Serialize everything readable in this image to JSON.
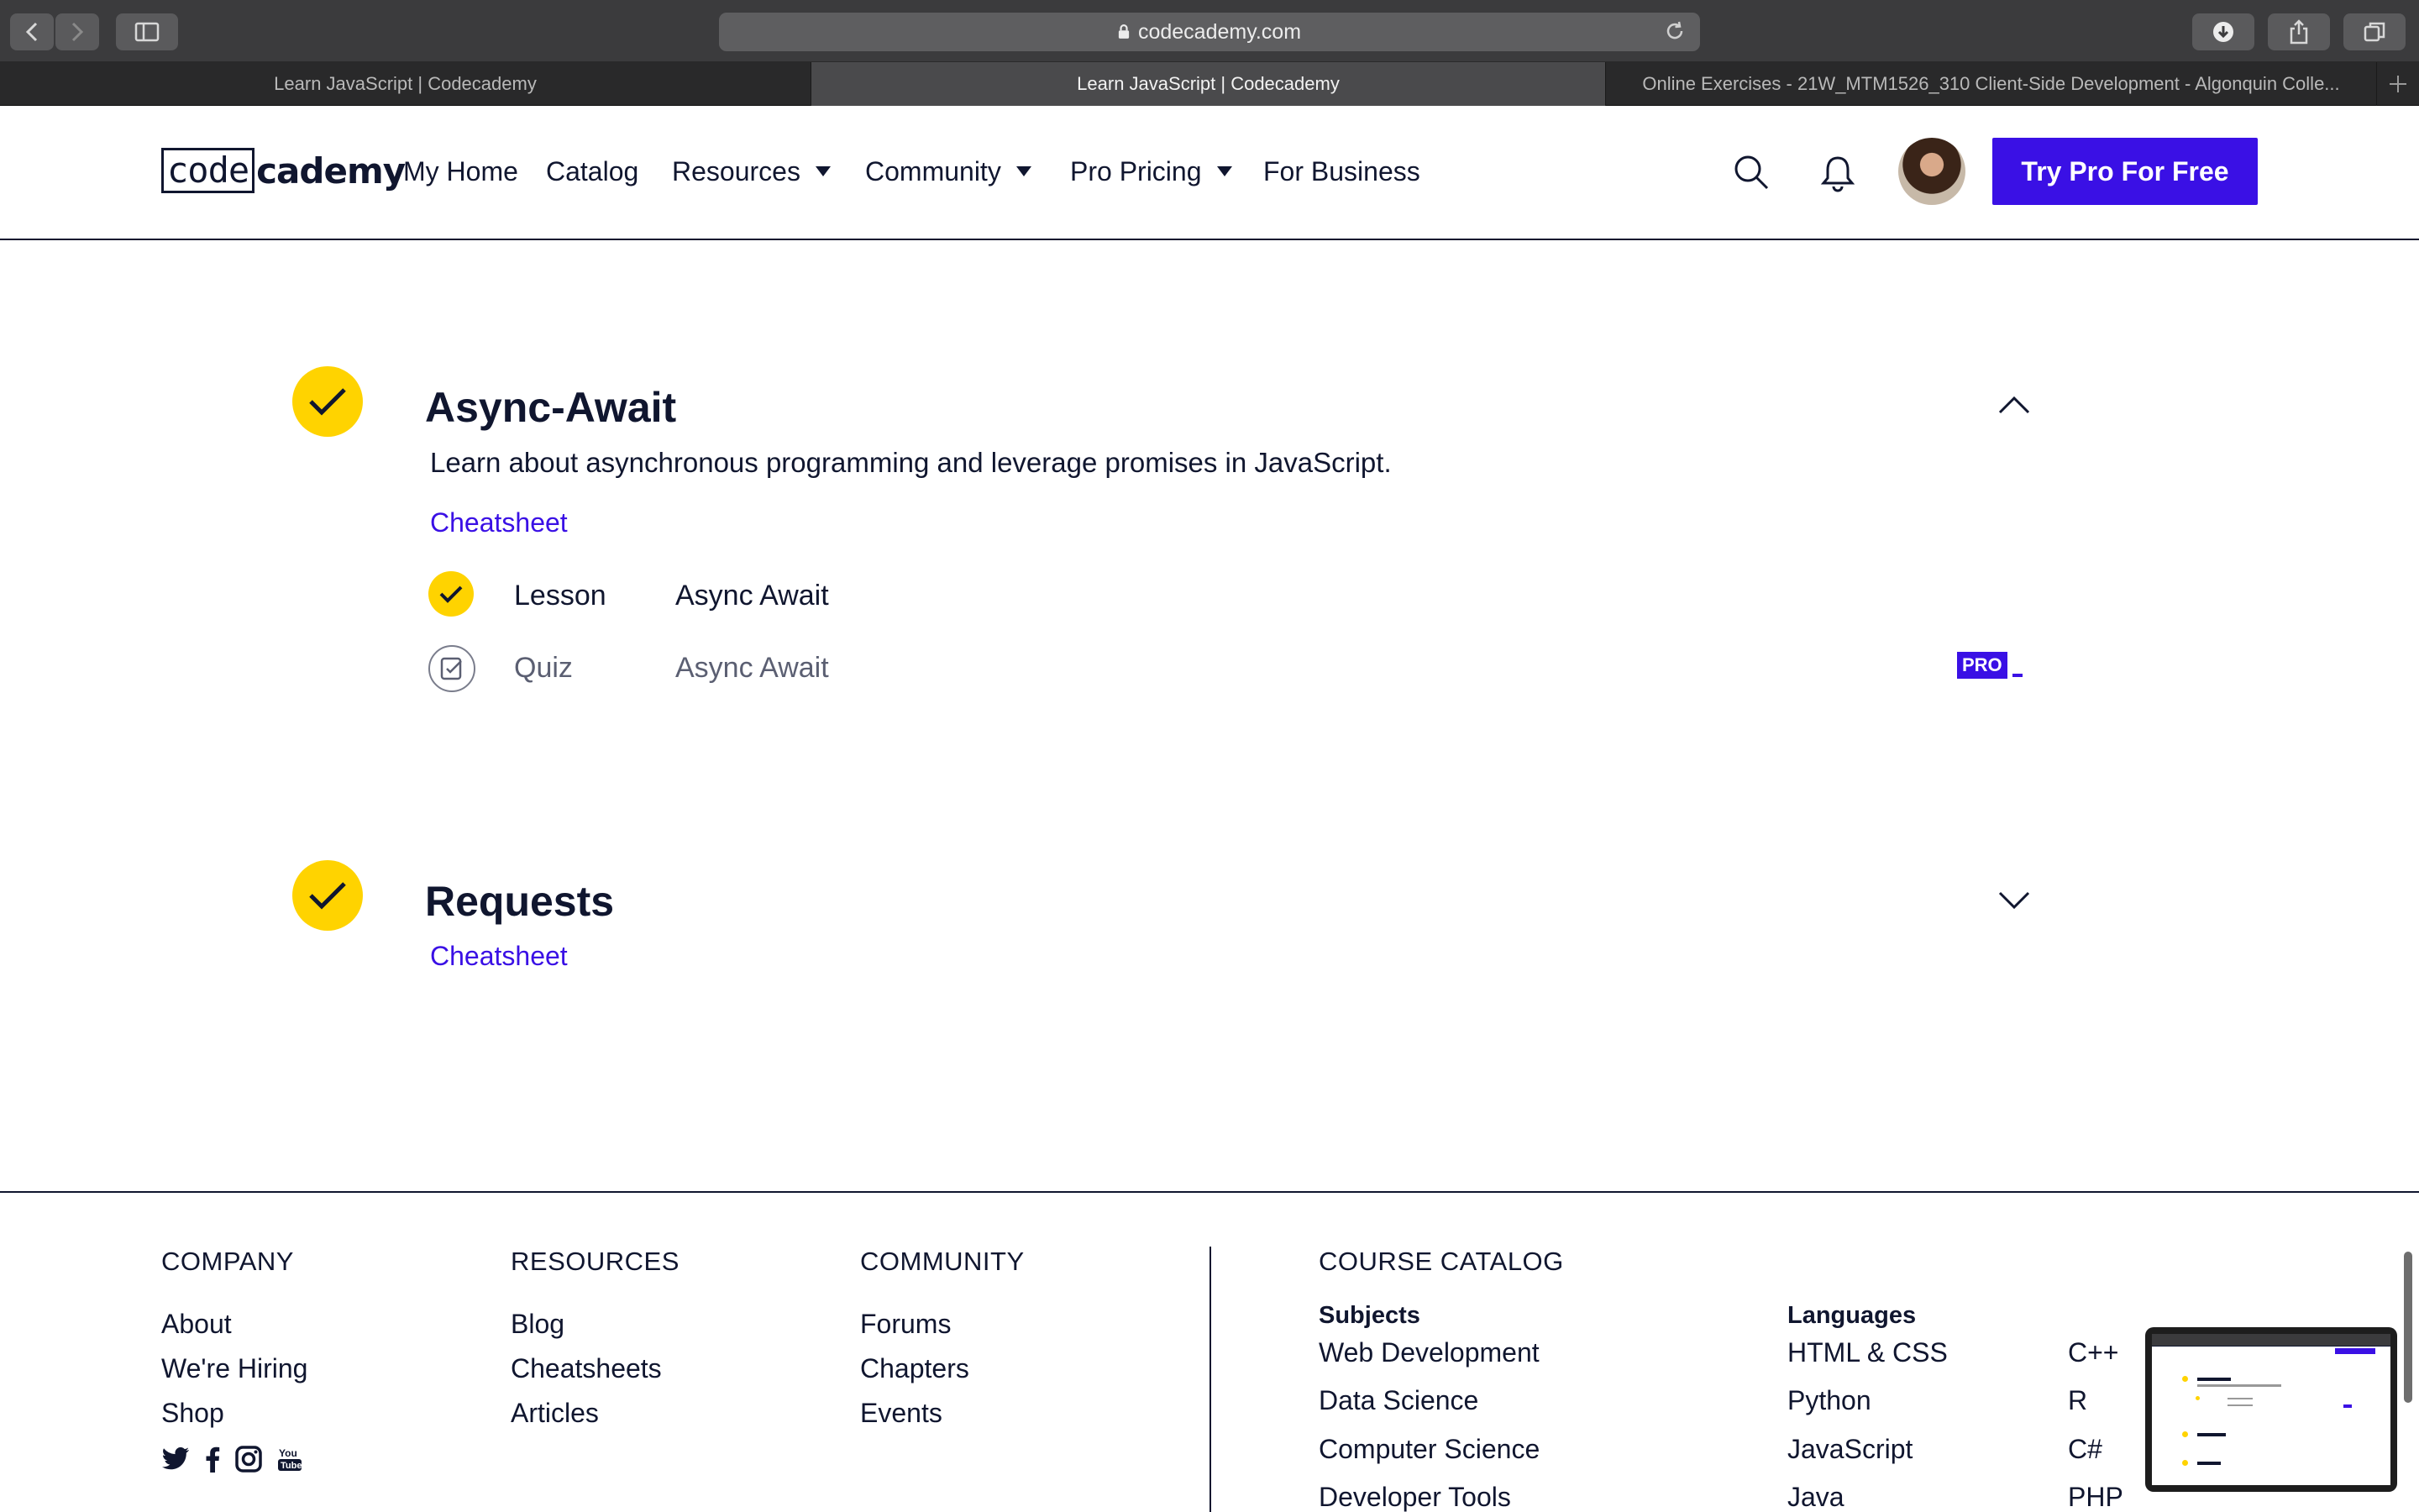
{
  "browser": {
    "url": "codecademy.com",
    "tabs": [
      {
        "title": "Learn JavaScript | Codecademy",
        "active": false
      },
      {
        "title": "Learn JavaScript | Codecademy",
        "active": true
      },
      {
        "title": "Online Exercises - 21W_MTM1526_310 Client-Side Development - Algonquin Colle...",
        "active": false
      }
    ]
  },
  "header": {
    "logo_box": "code",
    "logo_rest": "cademy",
    "nav": [
      {
        "label": "My Home",
        "dropdown": false
      },
      {
        "label": "Catalog",
        "dropdown": false
      },
      {
        "label": "Resources",
        "dropdown": true
      },
      {
        "label": "Community",
        "dropdown": true
      },
      {
        "label": "Pro Pricing",
        "dropdown": true
      },
      {
        "label": "For Business",
        "dropdown": false
      }
    ],
    "cta_label": "Try Pro For Free"
  },
  "modules": [
    {
      "title": "Async-Await",
      "completed": true,
      "expanded": true,
      "description": "Learn about asynchronous programming and leverage promises in JavaScript.",
      "cheatsheet_label": "Cheatsheet",
      "items": [
        {
          "type": "Lesson",
          "name": "Async Await",
          "completed": true,
          "pro": false
        },
        {
          "type": "Quiz",
          "name": "Async Await",
          "completed": false,
          "pro": true,
          "badge": "PRO"
        }
      ]
    },
    {
      "title": "Requests",
      "completed": true,
      "expanded": false,
      "cheatsheet_label": "Cheatsheet"
    }
  ],
  "footer": {
    "company": {
      "heading": "COMPANY",
      "links": [
        "About",
        "We're Hiring",
        "Shop"
      ]
    },
    "resources": {
      "heading": "RESOURCES",
      "links": [
        "Blog",
        "Cheatsheets",
        "Articles"
      ]
    },
    "community": {
      "heading": "COMMUNITY",
      "links": [
        "Forums",
        "Chapters",
        "Events"
      ]
    },
    "catalog": {
      "heading": "COURSE CATALOG",
      "subjects_heading": "Subjects",
      "subjects": [
        "Web Development",
        "Data Science",
        "Computer Science",
        "Developer Tools"
      ],
      "languages_heading": "Languages",
      "languages_col1": [
        "HTML & CSS",
        "Python",
        "JavaScript",
        "Java"
      ],
      "languages_col2": [
        "C++",
        "R",
        "C#",
        "PHP"
      ]
    },
    "social_icons": [
      "twitter-icon",
      "facebook-icon",
      "instagram-icon",
      "youtube-icon"
    ]
  },
  "colors": {
    "brand_blue": "#3a10e5",
    "check_yellow": "#ffd300",
    "navy": "#10162f"
  }
}
